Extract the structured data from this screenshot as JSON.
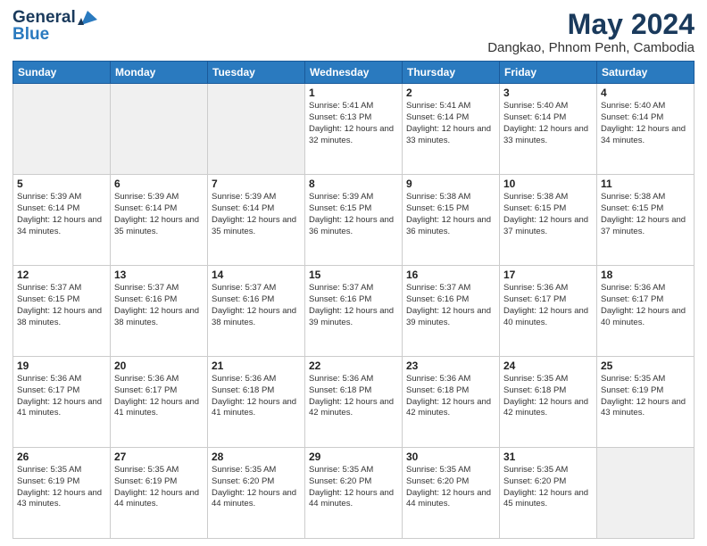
{
  "header": {
    "logo_line1": "General",
    "logo_line2": "Blue",
    "title": "May 2024",
    "subtitle": "Dangkao, Phnom Penh, Cambodia"
  },
  "weekdays": [
    "Sunday",
    "Monday",
    "Tuesday",
    "Wednesday",
    "Thursday",
    "Friday",
    "Saturday"
  ],
  "weeks": [
    [
      {
        "day": "",
        "info": ""
      },
      {
        "day": "",
        "info": ""
      },
      {
        "day": "",
        "info": ""
      },
      {
        "day": "1",
        "info": "Sunrise: 5:41 AM\nSunset: 6:13 PM\nDaylight: 12 hours\nand 32 minutes."
      },
      {
        "day": "2",
        "info": "Sunrise: 5:41 AM\nSunset: 6:14 PM\nDaylight: 12 hours\nand 33 minutes."
      },
      {
        "day": "3",
        "info": "Sunrise: 5:40 AM\nSunset: 6:14 PM\nDaylight: 12 hours\nand 33 minutes."
      },
      {
        "day": "4",
        "info": "Sunrise: 5:40 AM\nSunset: 6:14 PM\nDaylight: 12 hours\nand 34 minutes."
      }
    ],
    [
      {
        "day": "5",
        "info": "Sunrise: 5:39 AM\nSunset: 6:14 PM\nDaylight: 12 hours\nand 34 minutes."
      },
      {
        "day": "6",
        "info": "Sunrise: 5:39 AM\nSunset: 6:14 PM\nDaylight: 12 hours\nand 35 minutes."
      },
      {
        "day": "7",
        "info": "Sunrise: 5:39 AM\nSunset: 6:14 PM\nDaylight: 12 hours\nand 35 minutes."
      },
      {
        "day": "8",
        "info": "Sunrise: 5:39 AM\nSunset: 6:15 PM\nDaylight: 12 hours\nand 36 minutes."
      },
      {
        "day": "9",
        "info": "Sunrise: 5:38 AM\nSunset: 6:15 PM\nDaylight: 12 hours\nand 36 minutes."
      },
      {
        "day": "10",
        "info": "Sunrise: 5:38 AM\nSunset: 6:15 PM\nDaylight: 12 hours\nand 37 minutes."
      },
      {
        "day": "11",
        "info": "Sunrise: 5:38 AM\nSunset: 6:15 PM\nDaylight: 12 hours\nand 37 minutes."
      }
    ],
    [
      {
        "day": "12",
        "info": "Sunrise: 5:37 AM\nSunset: 6:15 PM\nDaylight: 12 hours\nand 38 minutes."
      },
      {
        "day": "13",
        "info": "Sunrise: 5:37 AM\nSunset: 6:16 PM\nDaylight: 12 hours\nand 38 minutes."
      },
      {
        "day": "14",
        "info": "Sunrise: 5:37 AM\nSunset: 6:16 PM\nDaylight: 12 hours\nand 38 minutes."
      },
      {
        "day": "15",
        "info": "Sunrise: 5:37 AM\nSunset: 6:16 PM\nDaylight: 12 hours\nand 39 minutes."
      },
      {
        "day": "16",
        "info": "Sunrise: 5:37 AM\nSunset: 6:16 PM\nDaylight: 12 hours\nand 39 minutes."
      },
      {
        "day": "17",
        "info": "Sunrise: 5:36 AM\nSunset: 6:17 PM\nDaylight: 12 hours\nand 40 minutes."
      },
      {
        "day": "18",
        "info": "Sunrise: 5:36 AM\nSunset: 6:17 PM\nDaylight: 12 hours\nand 40 minutes."
      }
    ],
    [
      {
        "day": "19",
        "info": "Sunrise: 5:36 AM\nSunset: 6:17 PM\nDaylight: 12 hours\nand 41 minutes."
      },
      {
        "day": "20",
        "info": "Sunrise: 5:36 AM\nSunset: 6:17 PM\nDaylight: 12 hours\nand 41 minutes."
      },
      {
        "day": "21",
        "info": "Sunrise: 5:36 AM\nSunset: 6:18 PM\nDaylight: 12 hours\nand 41 minutes."
      },
      {
        "day": "22",
        "info": "Sunrise: 5:36 AM\nSunset: 6:18 PM\nDaylight: 12 hours\nand 42 minutes."
      },
      {
        "day": "23",
        "info": "Sunrise: 5:36 AM\nSunset: 6:18 PM\nDaylight: 12 hours\nand 42 minutes."
      },
      {
        "day": "24",
        "info": "Sunrise: 5:35 AM\nSunset: 6:18 PM\nDaylight: 12 hours\nand 42 minutes."
      },
      {
        "day": "25",
        "info": "Sunrise: 5:35 AM\nSunset: 6:19 PM\nDaylight: 12 hours\nand 43 minutes."
      }
    ],
    [
      {
        "day": "26",
        "info": "Sunrise: 5:35 AM\nSunset: 6:19 PM\nDaylight: 12 hours\nand 43 minutes."
      },
      {
        "day": "27",
        "info": "Sunrise: 5:35 AM\nSunset: 6:19 PM\nDaylight: 12 hours\nand 44 minutes."
      },
      {
        "day": "28",
        "info": "Sunrise: 5:35 AM\nSunset: 6:20 PM\nDaylight: 12 hours\nand 44 minutes."
      },
      {
        "day": "29",
        "info": "Sunrise: 5:35 AM\nSunset: 6:20 PM\nDaylight: 12 hours\nand 44 minutes."
      },
      {
        "day": "30",
        "info": "Sunrise: 5:35 AM\nSunset: 6:20 PM\nDaylight: 12 hours\nand 44 minutes."
      },
      {
        "day": "31",
        "info": "Sunrise: 5:35 AM\nSunset: 6:20 PM\nDaylight: 12 hours\nand 45 minutes."
      },
      {
        "day": "",
        "info": ""
      }
    ]
  ]
}
